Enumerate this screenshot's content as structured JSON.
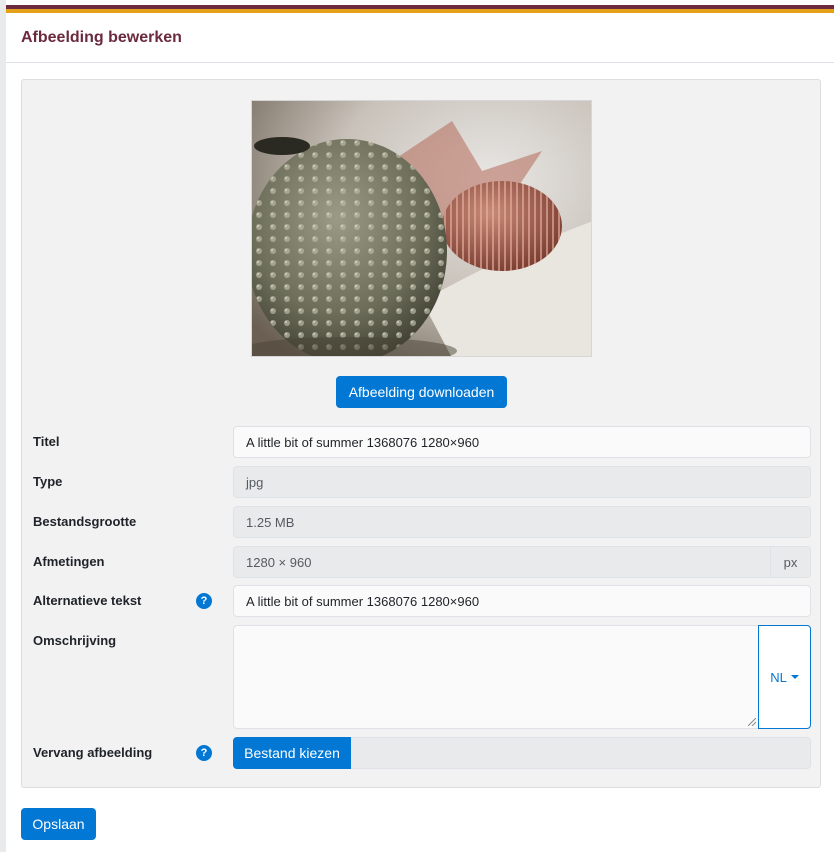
{
  "header": {
    "title": "Afbeelding bewerken"
  },
  "preview": {
    "image_icon": "sea-urchin-photo"
  },
  "actions": {
    "download_label": "Afbeelding downloaden",
    "save_label": "Opslaan"
  },
  "form": {
    "title": {
      "label": "Titel",
      "value": "A little bit of summer 1368076 1280×960"
    },
    "type": {
      "label": "Type",
      "value": "jpg"
    },
    "filesize": {
      "label": "Bestandsgrootte",
      "value": "1.25 MB"
    },
    "dimensions": {
      "label": "Afmetingen",
      "value": "1280 × 960",
      "unit": "px"
    },
    "alt_text": {
      "label": "Alternatieve tekst",
      "value": "A little bit of summer 1368076 1280×960",
      "help": "?"
    },
    "description": {
      "label": "Omschrijving",
      "value": "",
      "language": "NL"
    },
    "replace": {
      "label": "Vervang afbeelding",
      "button_label": "Bestand kiezen",
      "help": "?"
    }
  },
  "colors": {
    "accent": "#0277d4",
    "brand": "#6b2a3e",
    "stripe": "#e5a019"
  }
}
